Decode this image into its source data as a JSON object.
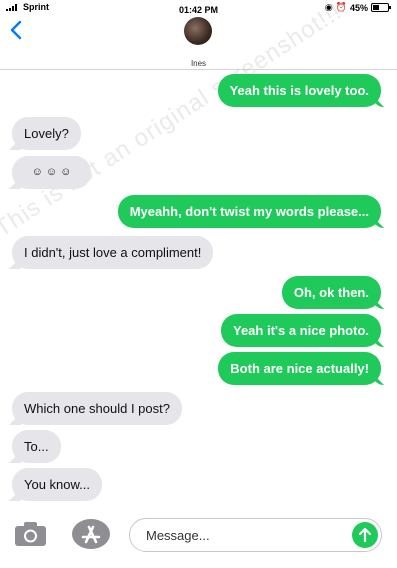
{
  "status": {
    "carrier": "Sprint",
    "time": "01:42 PM",
    "battery": "45%",
    "battery_level": 0.45
  },
  "header": {
    "contact_name": "Ines"
  },
  "messages": [
    {
      "text": "Yeah this is lovely too.",
      "from": "me"
    },
    {
      "text": "Lovely?",
      "from": "them"
    },
    {
      "text": "☺ ☺ ☺",
      "from": "them"
    },
    {
      "text": "Myeahh, don't twist my words please...",
      "from": "me"
    },
    {
      "text": "I didn't, just love a compliment!",
      "from": "them"
    },
    {
      "text": "Oh, ok then.",
      "from": "me"
    },
    {
      "text": "Yeah it's a nice photo.",
      "from": "me"
    },
    {
      "text": "Both are nice actually!",
      "from": "me"
    },
    {
      "text": "Which one should I post?",
      "from": "them"
    },
    {
      "text": "To...",
      "from": "them"
    },
    {
      "text": "You know...",
      "from": "them"
    }
  ],
  "watermark": "This is not an original screenshot!!!",
  "composer": {
    "placeholder": "Message..."
  },
  "colors": {
    "outgoing": "#1fc95a",
    "incoming": "#e5e5ea",
    "accent": "#007aff"
  },
  "icons": {
    "back": "chevron-left-icon",
    "camera": "camera-icon",
    "apps": "app-store-icon",
    "send": "send-arrow-icon"
  }
}
